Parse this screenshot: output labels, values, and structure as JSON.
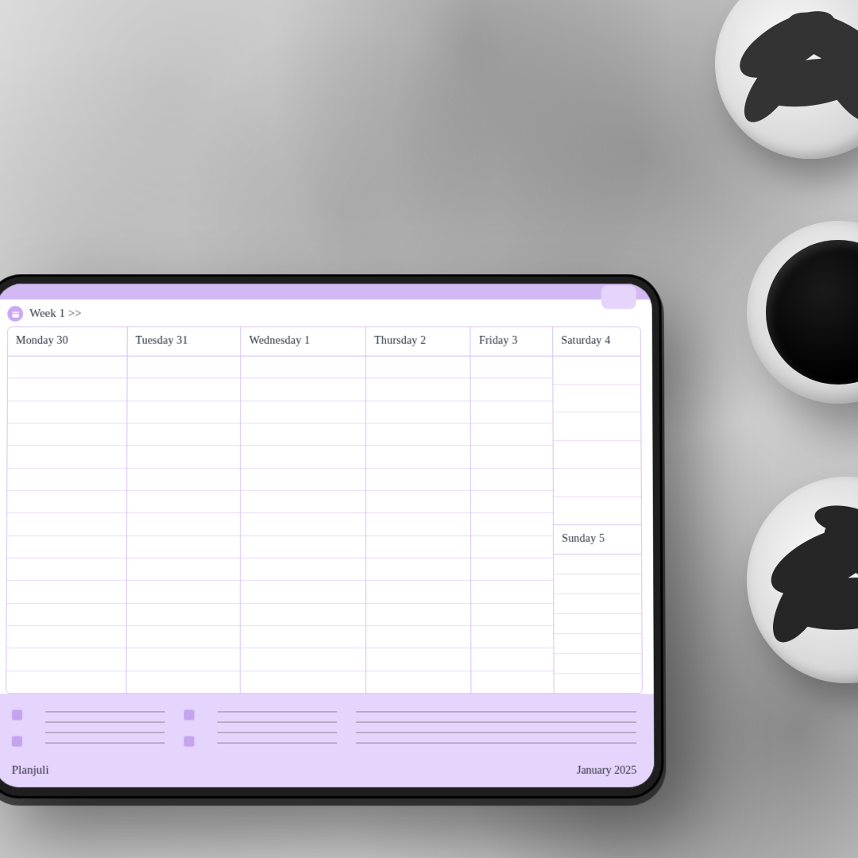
{
  "header": {
    "week_label": "Week 1 >>"
  },
  "days": [
    {
      "label": "Monday 30"
    },
    {
      "label": "Tuesday 31"
    },
    {
      "label": "Wednesday 1"
    },
    {
      "label": "Thursday 2"
    },
    {
      "label": "Friday 3"
    },
    {
      "label": "Saturday 4"
    },
    {
      "label": "Sunday 5"
    }
  ],
  "footer": {
    "brand": "Planjuli",
    "month_label": "January 2025"
  },
  "colors": {
    "accent": "#cba6f4",
    "panel": "#e5d4fb",
    "grid_line": "#d7c2f0",
    "slot_line": "#ead9fc"
  }
}
